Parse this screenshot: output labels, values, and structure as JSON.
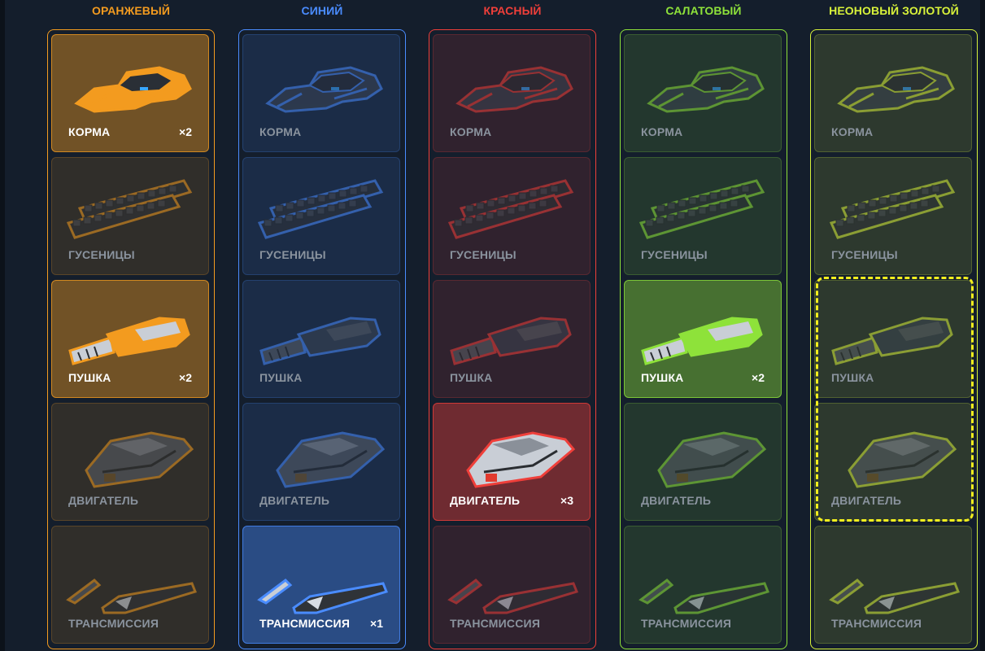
{
  "columns": [
    {
      "title": "ОРАНЖЕВЫЙ",
      "color": "#f39b1f",
      "parts": [
        {
          "label": "КОРМА",
          "count": "×2",
          "icon": "hull-icon",
          "owned": true
        },
        {
          "label": "ГУСЕНИЦЫ",
          "count": "",
          "icon": "tracks-icon",
          "owned": false
        },
        {
          "label": "ПУШКА",
          "count": "×2",
          "icon": "cannon-icon",
          "owned": true
        },
        {
          "label": "ДВИГАТЕЛЬ",
          "count": "",
          "icon": "engine-icon",
          "owned": false
        },
        {
          "label": "ТРАНСМИССИЯ",
          "count": "",
          "icon": "transmission-icon",
          "owned": false
        }
      ]
    },
    {
      "title": "СИНИЙ",
      "color": "#4a8cff",
      "parts": [
        {
          "label": "КОРМА",
          "count": "",
          "icon": "hull-icon",
          "owned": false
        },
        {
          "label": "ГУСЕНИЦЫ",
          "count": "",
          "icon": "tracks-icon",
          "owned": false
        },
        {
          "label": "ПУШКА",
          "count": "",
          "icon": "cannon-icon",
          "owned": false
        },
        {
          "label": "ДВИГАТЕЛЬ",
          "count": "",
          "icon": "engine-icon",
          "owned": false
        },
        {
          "label": "ТРАНСМИССИЯ",
          "count": "×1",
          "icon": "transmission-icon",
          "owned": true
        }
      ]
    },
    {
      "title": "КРАСНЫЙ",
      "color": "#ef3f3a",
      "parts": [
        {
          "label": "КОРМА",
          "count": "",
          "icon": "hull-icon",
          "owned": false
        },
        {
          "label": "ГУСЕНИЦЫ",
          "count": "",
          "icon": "tracks-icon",
          "owned": false
        },
        {
          "label": "ПУШКА",
          "count": "",
          "icon": "cannon-icon",
          "owned": false
        },
        {
          "label": "ДВИГАТЕЛЬ",
          "count": "×3",
          "icon": "engine-icon",
          "owned": true
        },
        {
          "label": "ТРАНСМИССИЯ",
          "count": "",
          "icon": "transmission-icon",
          "owned": false
        }
      ]
    },
    {
      "title": "САЛАТОВЫЙ",
      "color": "#8ee23a",
      "parts": [
        {
          "label": "КОРМА",
          "count": "",
          "icon": "hull-icon",
          "owned": false
        },
        {
          "label": "ГУСЕНИЦЫ",
          "count": "",
          "icon": "tracks-icon",
          "owned": false
        },
        {
          "label": "ПУШКА",
          "count": "×2",
          "icon": "cannon-icon",
          "owned": true
        },
        {
          "label": "ДВИГАТЕЛЬ",
          "count": "",
          "icon": "engine-icon",
          "owned": false
        },
        {
          "label": "ТРАНСМИССИЯ",
          "count": "",
          "icon": "transmission-icon",
          "owned": false
        }
      ]
    },
    {
      "title": "НЕОНОВЫЙ ЗОЛОТОЙ",
      "color": "#d8f23a",
      "parts": [
        {
          "label": "КОРМА",
          "count": "",
          "icon": "hull-icon",
          "owned": false
        },
        {
          "label": "ГУСЕНИЦЫ",
          "count": "",
          "icon": "tracks-icon",
          "owned": false
        },
        {
          "label": "ПУШКА",
          "count": "",
          "icon": "cannon-icon",
          "owned": false
        },
        {
          "label": "ДВИГАТЕЛЬ",
          "count": "",
          "icon": "engine-icon",
          "owned": false
        },
        {
          "label": "ТРАНСМИССИЯ",
          "count": "",
          "icon": "transmission-icon",
          "owned": false
        }
      ]
    }
  ],
  "highlight": {
    "column": 4,
    "parts": [
      2,
      3
    ],
    "color": "#f2ee1e"
  }
}
